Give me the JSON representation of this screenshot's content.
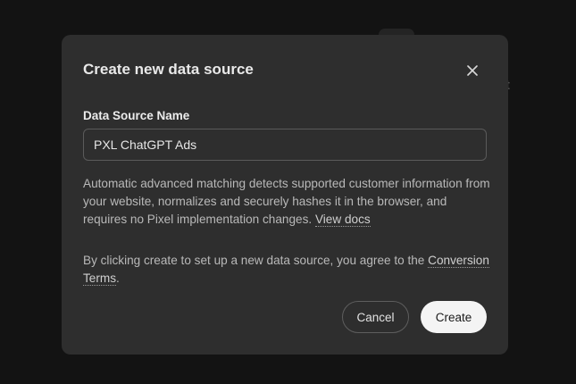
{
  "background": {
    "partial_text": "t"
  },
  "dialog": {
    "title": "Create new data source",
    "close_icon": "close-icon",
    "name_label": "Data Source Name",
    "name_value": "PXL ChatGPT Ads",
    "description": "Automatic advanced matching detects supported customer information from your website, normalizes and securely hashes it in the browser, and requires no Pixel implementation changes.",
    "view_docs_link": "View docs",
    "terms_text": "By clicking create to set up a new data source, you agree to the",
    "terms_link": "Conversion Terms",
    "terms_end": ".",
    "cancel_label": "Cancel",
    "create_label": "Create"
  },
  "colors": {
    "backdrop": "#131313",
    "dialog_bg": "#2e2e2e",
    "primary_button": "#f4f4f4"
  }
}
